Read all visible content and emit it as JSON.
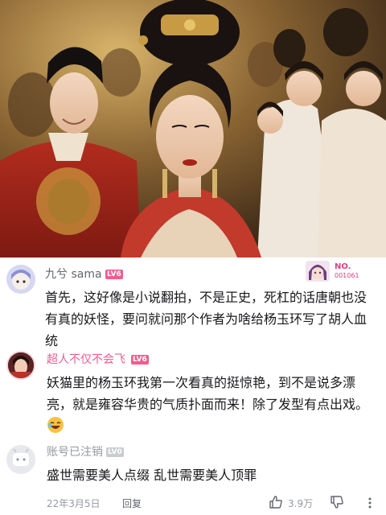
{
  "comments": [
    {
      "username": "九兮 sama",
      "level": "LV6",
      "badge": {
        "title": "NO.",
        "number": "001061"
      },
      "text": "首先，这好像是小说翻拍，不是正史，死杠的话唐朝也没有真的妖怪，要问就问那个作者为啥给杨玉环写了胡人血统"
    },
    {
      "username": "超人不仅不会飞",
      "level": "LV6",
      "text": "妖猫里的杨玉环我第一次看真的挺惊艳，到不是说多漂亮，就是雍容华贵的气质扑面而来！除了发型有点出戏。",
      "emoji": "laughing-face-icon"
    },
    {
      "username": "账号已注销",
      "level": "LV0",
      "text": "盛世需要美人点缀 乱世需要美人顶罪",
      "date": "22年3月5日",
      "reply_label": "回复",
      "likes": "3.9万"
    }
  ],
  "colors": {
    "vip_pink": "#f25d8e",
    "text_primary": "#18191c",
    "text_secondary": "#61666d",
    "text_muted": "#9499a0"
  }
}
